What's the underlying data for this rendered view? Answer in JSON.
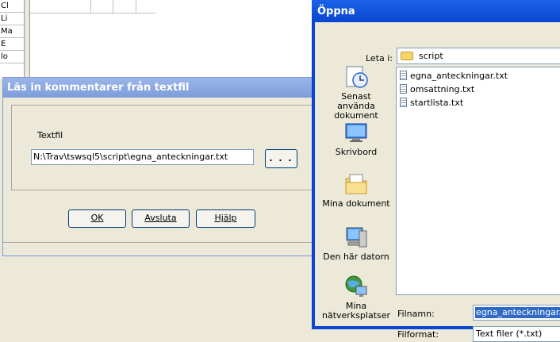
{
  "background": {
    "row_labels": [
      "Cl",
      "Li",
      "Ma",
      "E",
      "lo"
    ]
  },
  "import_dialog": {
    "title": "Läs in kommentarer från textfil",
    "textfil_label": "Textfil",
    "path_value": "N:\\Trav\\tswsql5\\script\\egna_anteckningar.txt",
    "browse_label": ". . .",
    "ok_label": "OK",
    "cancel_label": "Avsluta",
    "help_label": "Hjälp"
  },
  "open_dialog": {
    "title": "Öppna",
    "look_in_label": "Leta i:",
    "look_in_value": "script",
    "places": [
      {
        "label": "Senast använda dokument",
        "icon": "recent-documents-icon"
      },
      {
        "label": "Skrivbord",
        "icon": "desktop-icon"
      },
      {
        "label": "Mina dokument",
        "icon": "my-documents-icon"
      },
      {
        "label": "Den här datorn",
        "icon": "my-computer-icon"
      },
      {
        "label": "Mina nätverksplatser",
        "icon": "network-places-icon"
      }
    ],
    "files": [
      "egna_anteckningar.txt",
      "omsattning.txt",
      "startlista.txt"
    ],
    "filename_label": "Filnamn:",
    "filename_value": "egna_anteckningar.txt",
    "filetype_label": "Filformat:",
    "filetype_value": "Text filer (*.txt)"
  },
  "colors": {
    "xp_titlebar_active": "#0a46d0",
    "xp_titlebar_inactive": "#7d9cda",
    "dialog_face": "#ece9d8",
    "selection": "#316ac5"
  }
}
